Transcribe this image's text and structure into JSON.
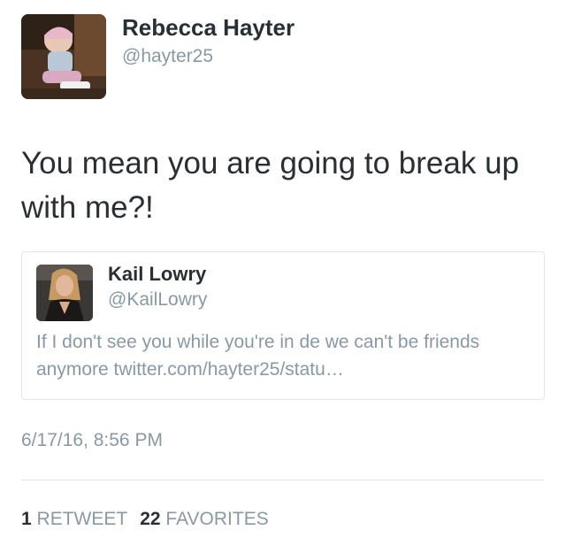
{
  "author": {
    "name": "Rebecca Hayter",
    "handle": "@hayter25"
  },
  "tweet": {
    "text": "You mean you are going to break up with me?!",
    "timestamp": "6/17/16, 8:56 PM"
  },
  "quoted": {
    "name": "Kail Lowry",
    "handle": "@KailLowry",
    "text": "If I don't see you while you're in de we can't be friends anymore  twitter.com/hayter25/statu…"
  },
  "stats": {
    "retweets_count": "1",
    "retweets_label": "RETWEET",
    "favorites_count": "22",
    "favorites_label": "FAVORITES"
  },
  "colors": {
    "text": "#292f33",
    "muted": "#8899a6",
    "border": "#e1e8ed"
  }
}
